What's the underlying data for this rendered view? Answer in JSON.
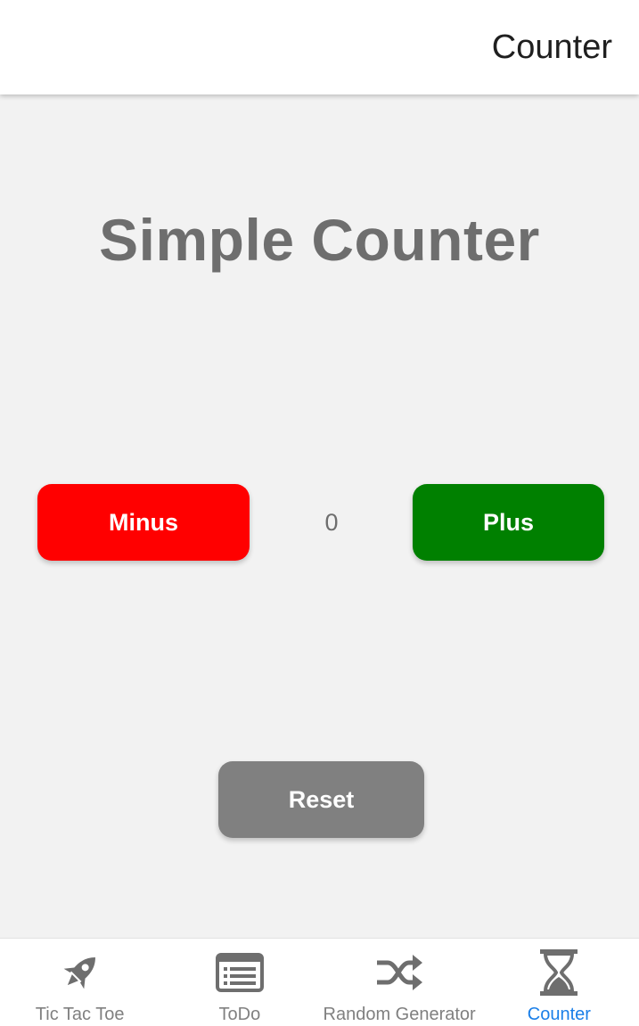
{
  "header": {
    "title": "Counter"
  },
  "main": {
    "title": "Simple Counter",
    "counter_value": "0",
    "minus_label": "Minus",
    "plus_label": "Plus",
    "reset_label": "Reset"
  },
  "colors": {
    "minus": "#ff0000",
    "plus": "#008000",
    "reset": "#808080",
    "active_tab": "#1a7fe8",
    "inactive_tab": "#808080"
  },
  "tabs": [
    {
      "label": "Tic Tac Toe",
      "icon": "rocket-icon",
      "active": false
    },
    {
      "label": "ToDo",
      "icon": "list-icon",
      "active": false
    },
    {
      "label": "Random Generator",
      "icon": "shuffle-icon",
      "active": false
    },
    {
      "label": "Counter",
      "icon": "hourglass-icon",
      "active": true
    }
  ]
}
